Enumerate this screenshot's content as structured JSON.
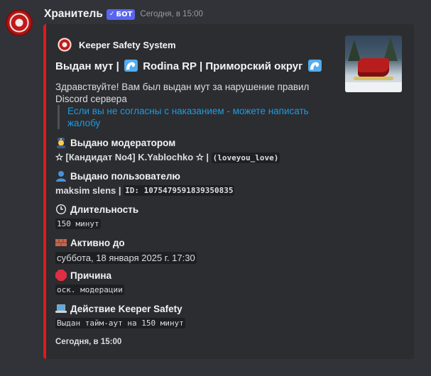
{
  "message": {
    "username": "Хранитель",
    "badge": "БОТ",
    "timestamp": "Сегодня, в 15:00"
  },
  "embed": {
    "accent_color": "#e0191b",
    "author": "Keeper Safety System",
    "title_part1": "Выдан мут |",
    "title_part2": "Rodina RP | Приморский округ",
    "description": "Здравствуйте! Вам был выдан мут за нарушение правил Discord сервера",
    "quote": "Если вы не согласны с наказанием - можете написать жалобу",
    "fields": {
      "moderator": {
        "name": "Выдано модератором",
        "value_text": "✫ [Кандидат No4] K.Yablochko ✫ |",
        "value_code": "(loveyou_love)",
        "icon": "police-officer-emoji"
      },
      "user": {
        "name": "Выдано пользователю",
        "value_text": "maksim slens |",
        "value_code": "ID: 1075479591839350835",
        "icon": "bust-silhouette-emoji"
      },
      "duration": {
        "name": "Длительность",
        "value_code": "150 минут",
        "icon": "clock-emoji"
      },
      "active_until": {
        "name": "Активно до",
        "value": "суббота, 18 января 2025 г. 17:30",
        "icon": "brick-emoji"
      },
      "reason": {
        "name": "Причина",
        "value_code": "оск. модерации",
        "icon": "stop-sign-emoji"
      },
      "action": {
        "name": "Действие Keeper Safety",
        "value_code": "Выдан тайм-аут на 150 минут",
        "icon": "laptop-emoji"
      }
    },
    "footer": "Сегодня, в 15:00"
  }
}
